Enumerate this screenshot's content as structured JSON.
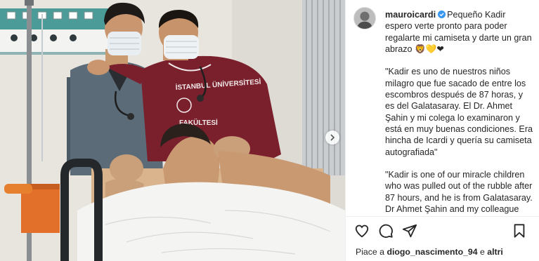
{
  "post": {
    "photo_alt": "",
    "username": "mauroicardi",
    "caption_text": "Pequeño Kadir espero verte pronto para poder regalarte mi camiseta y darte un gran abrazo 🦁💛❤\n\n\"Kadir es uno de nuestros niños milagro que fue sacado de entre los escombros después de 87 horas, y es del Galatasaray. El Dr. Ahmet Şahin y mi colega lo examinaron y está en muy buenas condiciones. Era hincha de Icardi y quería su camiseta autografiada\"\n\n\"Kadir is one of our miracle children who was pulled out of the rubble after 87 hours, and he is from Galatasaray.\nDr Ahmet Şahin and my colleague examined him and he is in very good condition. He was a fan of Icardi and wanted his autographed jersey\"",
    "likes_prefix": "Piace a",
    "likes_user": "diogo_nascimento_94",
    "likes_joiner": "e",
    "likes_others": "altri",
    "sweatshirt_text_1": "İSTANBUL ÜNİVERSİTESİ",
    "sweatshirt_text_2": "FAKÜLTESİ"
  },
  "icons": {
    "verified": "verified-badge-icon",
    "like": "heart-icon",
    "comment": "comment-bubble-icon",
    "share": "paper-plane-icon",
    "save": "bookmark-icon",
    "next": "chevron-right-icon"
  },
  "colors": {
    "verified_blue": "#3897f0",
    "text": "#262626",
    "wall_teal": "#3f8c8c",
    "scrubs": "#5c6b78",
    "hoodie": "#7a1f2c",
    "blanket": "#f4f4f2"
  }
}
